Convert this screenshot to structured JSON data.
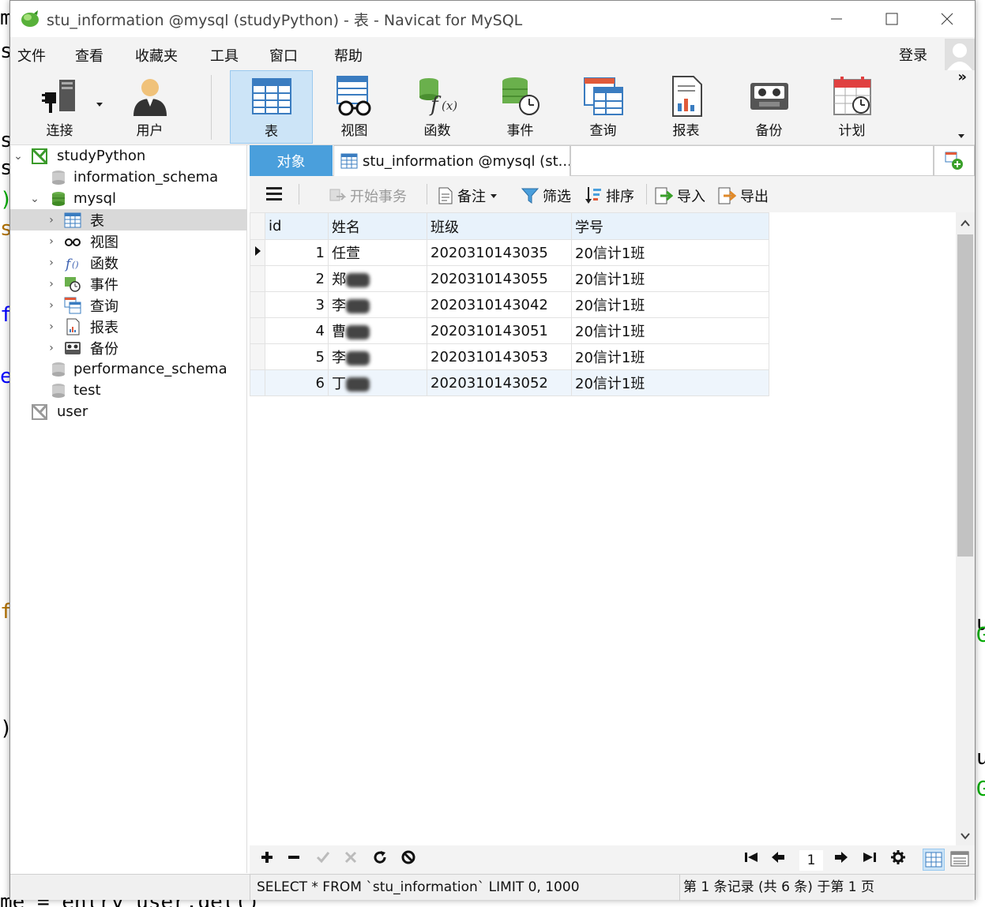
{
  "window": {
    "title": "stu_information @mysql (studyPython) - 表 - Navicat for MySQL"
  },
  "menu": [
    "文件",
    "查看",
    "收藏夹",
    "工具",
    "窗口",
    "帮助"
  ],
  "login_label": "登录",
  "toolbar": {
    "connect": "连接",
    "user": "用户",
    "table": "表",
    "view": "视图",
    "function": "函数",
    "event": "事件",
    "query": "查询",
    "report": "报表",
    "backup": "备份",
    "schedule": "计划",
    "more": "»"
  },
  "tree": {
    "connection": "studyPython",
    "databases": [
      "information_schema",
      "mysql",
      "performance_schema",
      "test"
    ],
    "mysql_children": [
      "表",
      "视图",
      "函数",
      "事件",
      "查询",
      "报表",
      "备份"
    ],
    "other_connection": "user"
  },
  "tabs": {
    "objects": "对象",
    "table_tab": "stu_information @mysql (st..."
  },
  "grid_toolbar": {
    "begin_transaction": "开始事务",
    "memo": "备注",
    "filter": "筛选",
    "sort": "排序",
    "import": "导入",
    "export": "导出"
  },
  "table": {
    "columns": [
      "id",
      "姓名",
      "班级",
      "学号"
    ],
    "rows": [
      {
        "id": "1",
        "name": "任萱",
        "name_redacted": false,
        "class": "2020310143035",
        "student_no": "20信计1班"
      },
      {
        "id": "2",
        "name": "郑",
        "name_redacted": true,
        "class": "2020310143055",
        "student_no": "20信计1班"
      },
      {
        "id": "3",
        "name": "李",
        "name_redacted": true,
        "class": "2020310143042",
        "student_no": "20信计1班"
      },
      {
        "id": "4",
        "name": "曹",
        "name_redacted": true,
        "class": "2020310143051",
        "student_no": "20信计1班"
      },
      {
        "id": "5",
        "name": "李",
        "name_redacted": true,
        "class": "2020310143053",
        "student_no": "20信计1班"
      },
      {
        "id": "6",
        "name": "丁",
        "name_redacted": true,
        "class": "2020310143052",
        "student_no": "20信计1班"
      }
    ]
  },
  "nav": {
    "page": "1"
  },
  "status": {
    "sql": "SELECT * FROM `stu_information` LIMIT 0, 1000",
    "records": "第 1 条记录 (共 6 条) 于第 1 页"
  },
  "background_editor": {
    "bottom_line": "me = entry_user.get()"
  },
  "colors": {
    "accent": "#4a9fdc",
    "selected_tool": "#cce4f7",
    "header_bg": "#e8f2fb"
  }
}
